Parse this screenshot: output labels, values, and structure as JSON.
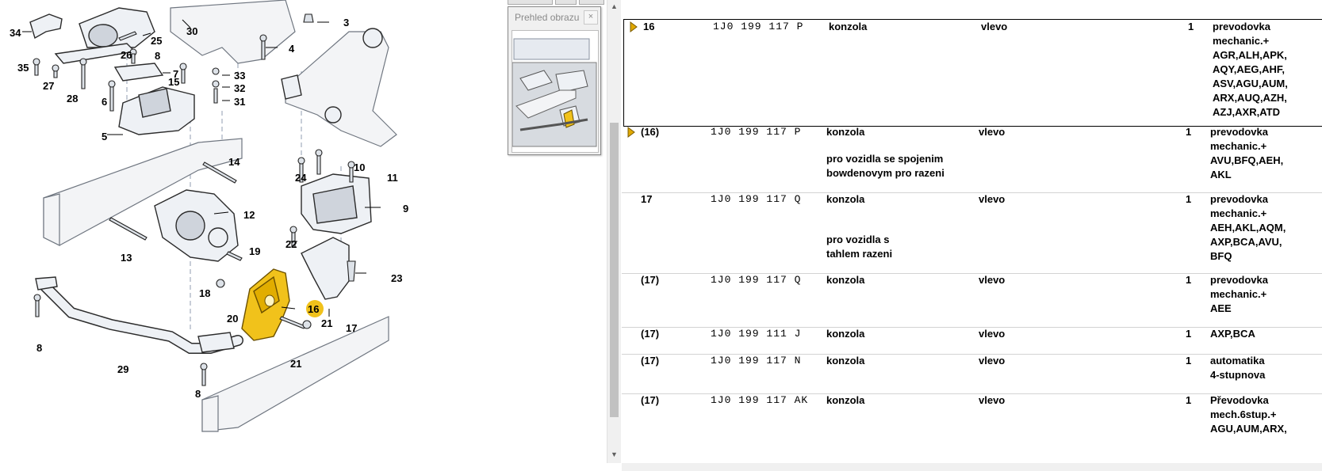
{
  "overview": {
    "title": "Prehled obrazu",
    "close_glyph": "×"
  },
  "diagram": {
    "callouts": [
      "34",
      "25",
      "30",
      "3",
      "26",
      "8",
      "35",
      "27",
      "7",
      "4",
      "33",
      "32",
      "15",
      "31",
      "28",
      "6",
      "5",
      "14",
      "12",
      "10",
      "11",
      "24",
      "9",
      "22",
      "13",
      "19",
      "23",
      "18",
      "16",
      "20",
      "21",
      "17",
      "8",
      "29",
      "21",
      "8"
    ]
  },
  "parts": [
    {
      "pos": "16",
      "part_no": "1J0 199 117 P",
      "name": "konzola",
      "side": "vlevo",
      "qty": "1",
      "remark": [
        "prevodovka",
        "mechanic.+",
        "AGR,ALH,APK,",
        "AQY,AEG,AHF,",
        "ASV,AGU,AUM,",
        "ARX,AUQ,AZH,",
        "AZJ,AXR,ATD"
      ],
      "note": [],
      "marker": true,
      "selected": true
    },
    {
      "pos": "(16)",
      "part_no": "1J0 199 117 P",
      "name": "konzola",
      "side": "vlevo",
      "qty": "1",
      "remark": [
        "prevodovka",
        "mechanic.+",
        "AVU,BFQ,AEH,",
        "AKL"
      ],
      "note": [
        "pro vozidla se spojenim",
        "bowdenovym pro razeni"
      ],
      "marker": true,
      "selected": false
    },
    {
      "pos": "17",
      "part_no": "1J0 199 117 Q",
      "name": "konzola",
      "side": "vlevo",
      "qty": "1",
      "remark": [
        "prevodovka",
        "mechanic.+",
        "AEH,AKL,AQM,",
        "AXP,BCA,AVU,",
        "BFQ"
      ],
      "note": [
        "pro vozidla s",
        "tahlem razeni"
      ],
      "marker": false,
      "selected": false
    },
    {
      "pos": "(17)",
      "part_no": "1J0 199 117 Q",
      "name": "konzola",
      "side": "vlevo",
      "qty": "1",
      "remark": [
        "prevodovka",
        "mechanic.+",
        "AEE"
      ],
      "note": [],
      "marker": false,
      "selected": false
    },
    {
      "pos": "(17)",
      "part_no": "1J0 199 111 J",
      "name": "konzola",
      "side": "vlevo",
      "qty": "1",
      "remark": [
        "AXP,BCA"
      ],
      "note": [],
      "marker": false,
      "selected": false
    },
    {
      "pos": "(17)",
      "part_no": "1J0 199 117 N",
      "name": "konzola",
      "side": "vlevo",
      "qty": "1",
      "remark": [
        "automatika",
        "4-stupnova"
      ],
      "note": [],
      "marker": false,
      "selected": false
    },
    {
      "pos": "(17)",
      "part_no": "1J0 199 117 AK",
      "name": "konzola",
      "side": "vlevo",
      "qty": "1",
      "remark": [
        "Převodovka",
        "mech.6stup.+",
        "AGU,AUM,ARX,"
      ],
      "note": [],
      "marker": false,
      "selected": false
    }
  ],
  "colors": {
    "highlight": "#f1c21b",
    "marker": "#e0a800"
  },
  "scrollbar": {
    "up_glyph": "▲",
    "down_glyph": "▼"
  }
}
